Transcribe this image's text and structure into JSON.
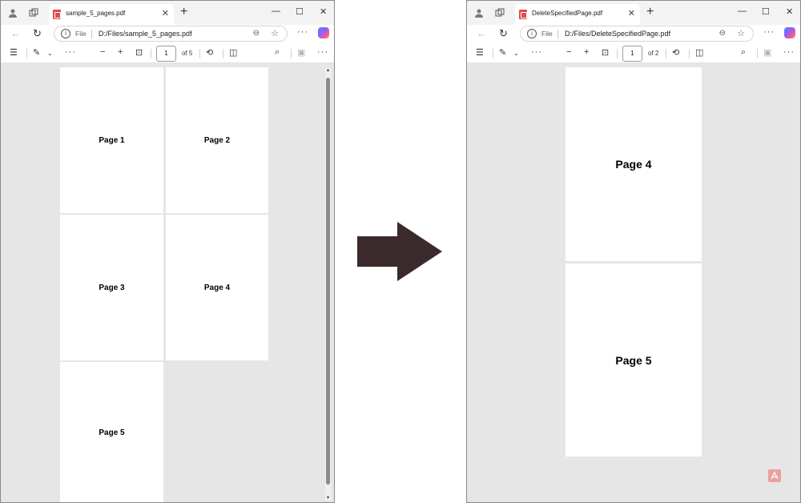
{
  "left": {
    "tab_title": "sample_5_pages.pdf",
    "scheme": "File",
    "url": "D:/Files/sample_5_pages.pdf",
    "current_page": "1",
    "page_count": "of 5",
    "pages": [
      "Page 1",
      "Page 2",
      "Page 3",
      "Page 4",
      "Page 5"
    ]
  },
  "right": {
    "tab_title": "DeleteSpecifiedPage.pdf",
    "scheme": "File",
    "url": "D:/Files/DeleteSpecifiedPage.pdf",
    "current_page": "1",
    "page_count": "of 2",
    "pages": [
      "Page 4",
      "Page 5"
    ]
  },
  "colors": {
    "arrow": "#3a2a2c",
    "viewer_background": "#e6e6e6",
    "pdf_icon": "#e04b4b"
  },
  "icons": {
    "profile": "profile-icon",
    "workspaces": "workspaces-icon",
    "pdf": "pdf-file-icon",
    "close_tab": "close-icon",
    "new_tab": "plus-icon",
    "back": "back-arrow-icon",
    "refresh": "refresh-icon",
    "info": "info-icon",
    "zoom": "zoom-icon",
    "favorite": "star-icon",
    "more": "more-icon",
    "copilot": "copilot-icon",
    "contents": "contents-icon",
    "draw": "draw-icon",
    "zoom_out": "minus-icon",
    "zoom_in": "plus-icon",
    "fit": "fit-page-icon",
    "rotate": "rotate-icon",
    "page_view": "page-view-icon",
    "search": "search-icon",
    "save": "save-icon",
    "arrow": "right-arrow-icon",
    "acrobat": "acrobat-icon"
  }
}
